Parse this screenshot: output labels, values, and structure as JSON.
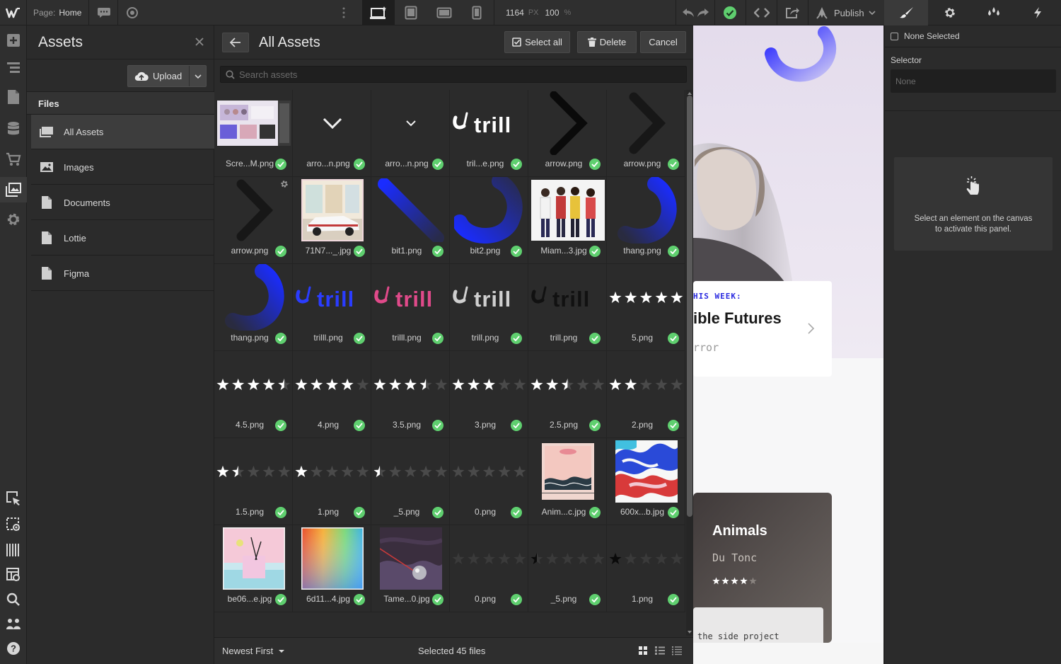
{
  "topbar": {
    "page_label": "Page:",
    "page_name": "Home",
    "width_value": "1164",
    "width_unit": "PX",
    "zoom_value": "100",
    "zoom_unit": "%",
    "publish_label": "Publish"
  },
  "assets_panel": {
    "title": "Assets",
    "upload_label": "Upload",
    "files_header": "Files",
    "items": [
      {
        "label": "All Assets",
        "icon": "all-assets-icon",
        "active": true
      },
      {
        "label": "Images",
        "icon": "image-icon"
      },
      {
        "label": "Documents",
        "icon": "document-icon"
      },
      {
        "label": "Lottie",
        "icon": "document-icon"
      },
      {
        "label": "Figma",
        "icon": "document-icon"
      }
    ]
  },
  "main": {
    "title": "All Assets",
    "select_all_label": "Select all",
    "delete_label": "Delete",
    "cancel_label": "Cancel",
    "search_placeholder": "Search assets",
    "sort_label": "Newest First",
    "selected_text": "Selected 45 files",
    "assets": [
      {
        "name": "Scre...M.png",
        "kind": "screenshot"
      },
      {
        "name": "arro...n.png",
        "kind": "chevron-down"
      },
      {
        "name": "arro...n.png",
        "kind": "chevron-down-small"
      },
      {
        "name": "tril...e.png",
        "kind": "trill-white"
      },
      {
        "name": "arrow.png",
        "kind": "arrow-black"
      },
      {
        "name": "arrow.png",
        "kind": "arrow-dark"
      },
      {
        "name": "arrow.png",
        "kind": "arrow-dark"
      },
      {
        "name": "71N7..._.jpg",
        "kind": "car"
      },
      {
        "name": "bit1.png",
        "kind": "blue-stroke"
      },
      {
        "name": "bit2.png",
        "kind": "blue-curve"
      },
      {
        "name": "Miam...3.jpg",
        "kind": "people"
      },
      {
        "name": "thang.png",
        "kind": "blue-arc"
      },
      {
        "name": "thang.png",
        "kind": "blue-arc"
      },
      {
        "name": "trilll.png",
        "kind": "trill-blue"
      },
      {
        "name": "trilll.png",
        "kind": "trill-pink"
      },
      {
        "name": "trill.png",
        "kind": "trill-grey"
      },
      {
        "name": "trill.png",
        "kind": "trill-black"
      },
      {
        "name": "5.png",
        "kind": "stars",
        "rating": 5
      },
      {
        "name": "4.5.png",
        "kind": "stars",
        "rating": 4.5
      },
      {
        "name": "4.png",
        "kind": "stars",
        "rating": 4
      },
      {
        "name": "3.5.png",
        "kind": "stars",
        "rating": 3.5
      },
      {
        "name": "3.png",
        "kind": "stars",
        "rating": 3
      },
      {
        "name": "2.5.png",
        "kind": "stars",
        "rating": 2.5
      },
      {
        "name": "2.png",
        "kind": "stars",
        "rating": 2
      },
      {
        "name": "1.5.png",
        "kind": "stars",
        "rating": 1.5
      },
      {
        "name": "1.png",
        "kind": "stars",
        "rating": 1
      },
      {
        "name": "_5.png",
        "kind": "stars",
        "rating": 0.5
      },
      {
        "name": "0.png",
        "kind": "stars",
        "rating": 0
      },
      {
        "name": "Anim...c.jpg",
        "kind": "album-pink"
      },
      {
        "name": "600x...b.jpg",
        "kind": "album-pattern"
      },
      {
        "name": "be06...e.jpg",
        "kind": "album-pool"
      },
      {
        "name": "6d11...4.jpg",
        "kind": "album-gradient"
      },
      {
        "name": "Tame...0.jpg",
        "kind": "album-tame"
      },
      {
        "name": "0.png",
        "kind": "stars-dark",
        "rating": 0
      },
      {
        "name": "_5.png",
        "kind": "stars-dark",
        "rating": 0.5
      },
      {
        "name": "1.png",
        "kind": "stars-dark",
        "rating": 1
      }
    ]
  },
  "canvas": {
    "week_label": "HIS WEEK:",
    "card_title": "ible Futures",
    "card_sub": "rror",
    "animals_title": "Animals",
    "animals_artist": "Du Tonc",
    "animals_rating": 4,
    "side_project": "the side project"
  },
  "right_panel": {
    "none_selected": "None Selected",
    "selector_label": "Selector",
    "selector_placeholder": "None",
    "activate_line1": "Select an element on the canvas",
    "activate_line2": "to activate this panel."
  },
  "colors": {
    "accent_green": "#5fcf6f",
    "brand_blue": "#1a2cff"
  }
}
